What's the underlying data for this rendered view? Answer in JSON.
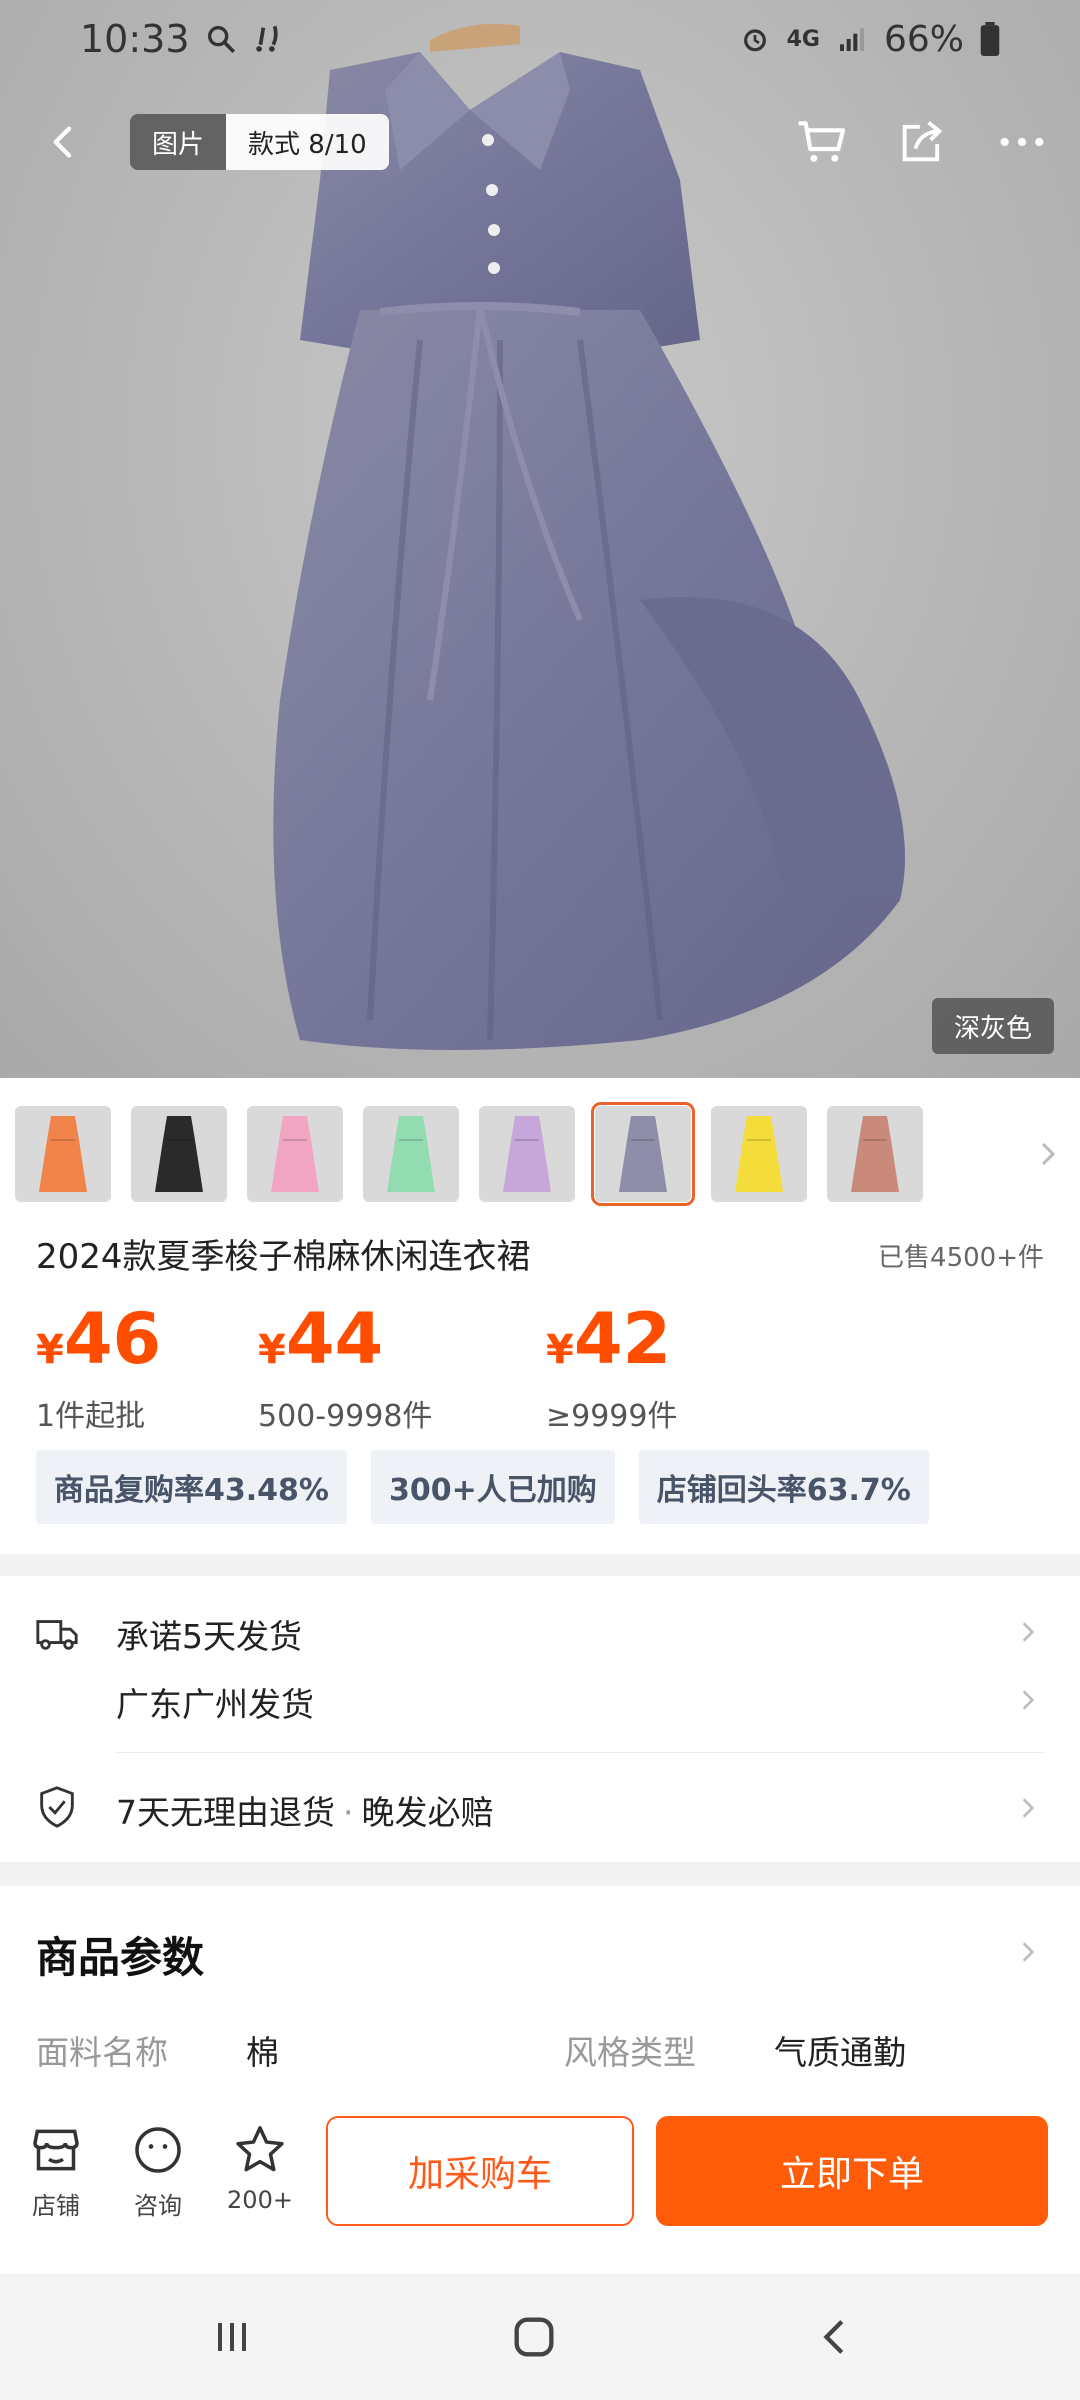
{
  "status_bar": {
    "time": "10:33",
    "network": "4G",
    "battery": "66%"
  },
  "top_nav": {
    "segment_image": "图片",
    "segment_style": "款式 8/10"
  },
  "hero": {
    "color_tag": "深灰色"
  },
  "thumbs": [
    {
      "name": "orange",
      "color": "#f0844a"
    },
    {
      "name": "black",
      "color": "#2a2a2a"
    },
    {
      "name": "pink",
      "color": "#f1a5c3"
    },
    {
      "name": "green",
      "color": "#93dcb2"
    },
    {
      "name": "lavender",
      "color": "#c7a6d9"
    },
    {
      "name": "dark-gray",
      "color": "#8e8ea8",
      "selected": true
    },
    {
      "name": "yellow",
      "color": "#f4dc3a"
    },
    {
      "name": "rose",
      "color": "#c98a7c"
    }
  ],
  "product": {
    "title": "2024款夏季梭子棉麻休闲连衣裙",
    "sold": "已售4500+件",
    "prices": [
      {
        "symbol": "¥",
        "value": "46",
        "caption": "1件起批"
      },
      {
        "symbol": "¥",
        "value": "44",
        "caption": "500-9998件"
      },
      {
        "symbol": "¥",
        "value": "42",
        "caption": "≥9999件"
      }
    ],
    "badges": [
      "商品复购率43.48%",
      "300+人已加购",
      "店铺回头率63.7%"
    ]
  },
  "shipping": {
    "promise": "承诺5天发货",
    "origin": "广东广州发货",
    "return_policy": "7天无理由退货",
    "late_compensation": "晚发必赔",
    "separator": "·"
  },
  "params": {
    "title": "商品参数",
    "items": [
      {
        "label": "面料名称",
        "value": "棉"
      },
      {
        "label": "风格类型",
        "value": "气质通勤"
      }
    ]
  },
  "actionbar": {
    "store": "店铺",
    "consult": "咨询",
    "favorites": "200+",
    "add_cart": "加采购车",
    "buy_now": "立即下单"
  },
  "colors": {
    "accent": "#ff5c0a",
    "price": "#ff4d00",
    "dress": "#7d7d9a"
  }
}
